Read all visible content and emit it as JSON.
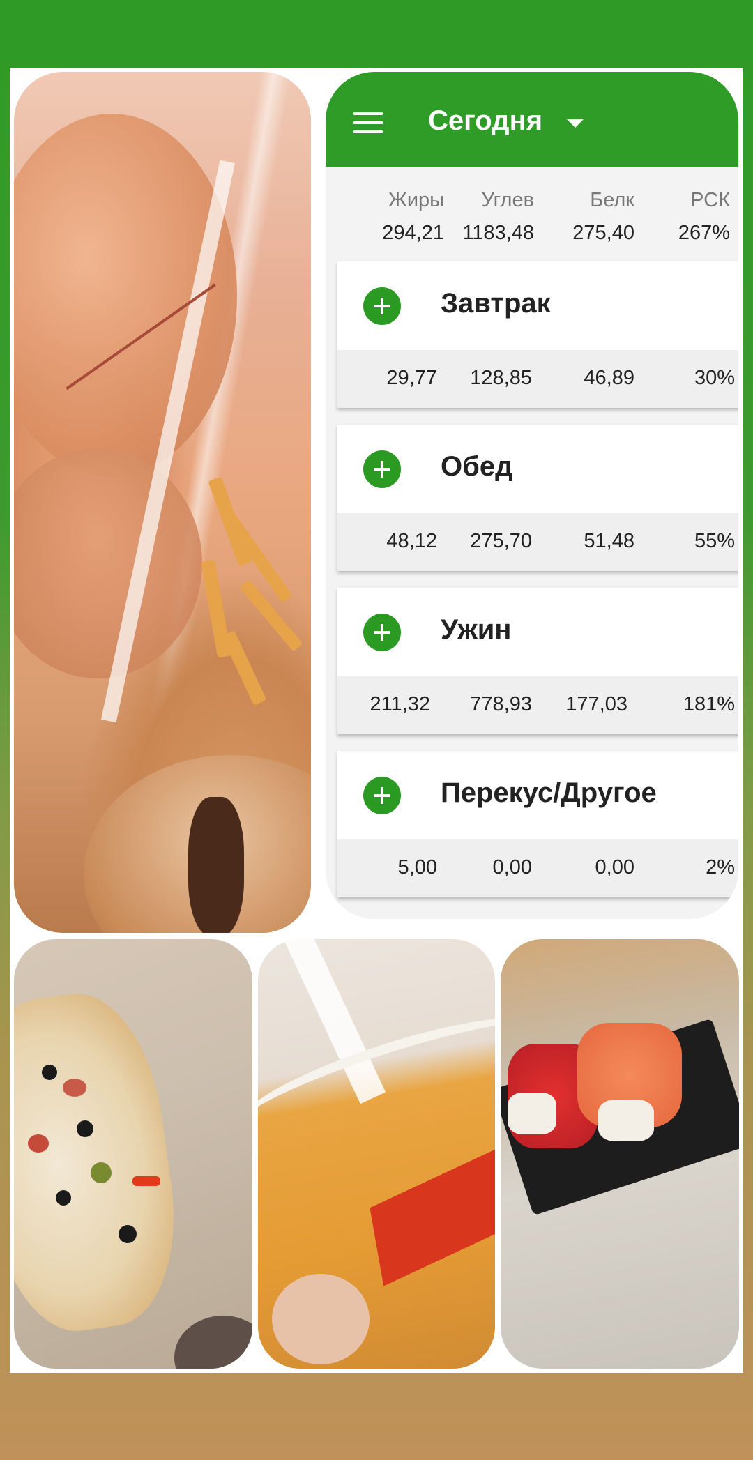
{
  "toolbar": {
    "title": "Сегодня",
    "menu_icon": "hamburger-menu-icon",
    "dropdown_icon": "caret-down-icon"
  },
  "summary": {
    "headers": [
      "Жиры",
      "Углев",
      "Белк",
      "РСК"
    ],
    "values": [
      "294,21",
      "1183,48",
      "275,40",
      "267%"
    ]
  },
  "meals": [
    {
      "name": "Завтрак",
      "values": [
        "29,77",
        "128,85",
        "46,89",
        "30%"
      ]
    },
    {
      "name": "Обед",
      "values": [
        "48,12",
        "275,70",
        "51,48",
        "55%"
      ]
    },
    {
      "name": "Ужин",
      "values": [
        "211,32",
        "778,93",
        "177,03",
        "181%"
      ]
    },
    {
      "name": "Перекус/Другое",
      "values": [
        "5,00",
        "0,00",
        "0,00",
        "2%"
      ]
    }
  ],
  "colors": {
    "brand_green": "#2e9c26",
    "accent_button": "#2a9a22"
  }
}
